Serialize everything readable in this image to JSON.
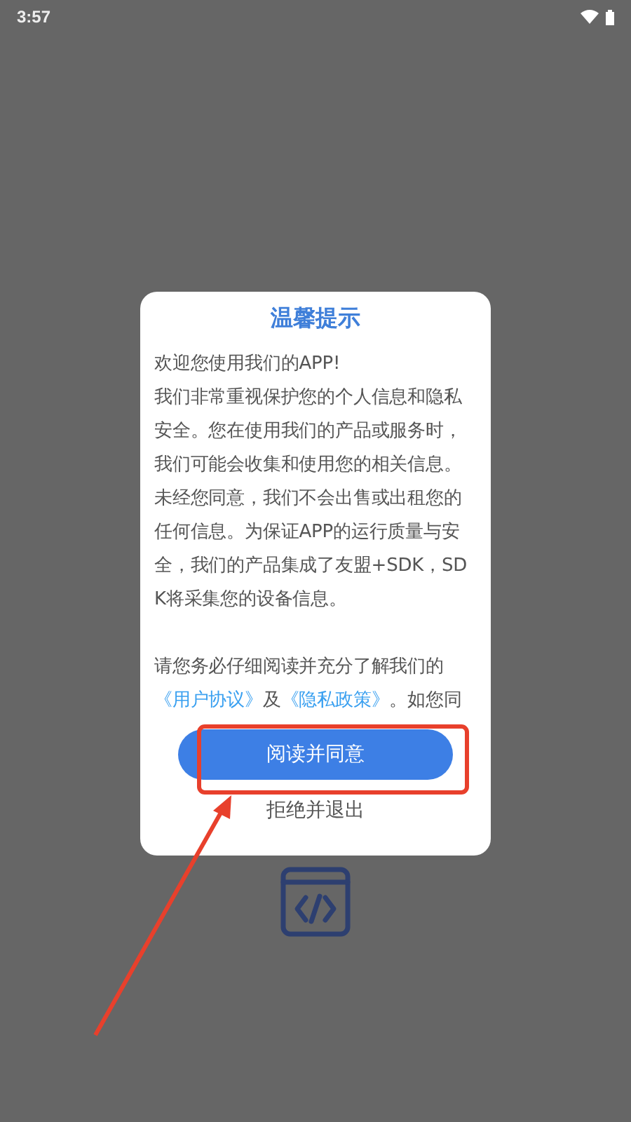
{
  "status_bar": {
    "time": "3:57"
  },
  "dialog": {
    "title": "温馨提示",
    "paragraphs": [
      "欢迎您使用我们的APP!\n我们非常重视保护您的个人信息和隐私安全。您在使用我们的产品或服务时，我们可能会收集和使用您的相关信息。未经您同意，我们不会出售或出租您的任何信息。为保证APP的运行质量与安全，我们的产品集成了友盟+SDK，SDK将采集您的设备信息。"
    ],
    "consent": {
      "intro": "请您务必仔细阅读并充分了解我们的",
      "link_1": "《用户协议》",
      "joiner": "及",
      "link_2": "《隐私政策》",
      "tail": "。如您同"
    },
    "agree_button": "阅读并同意",
    "decline_button": "拒绝并退出"
  }
}
